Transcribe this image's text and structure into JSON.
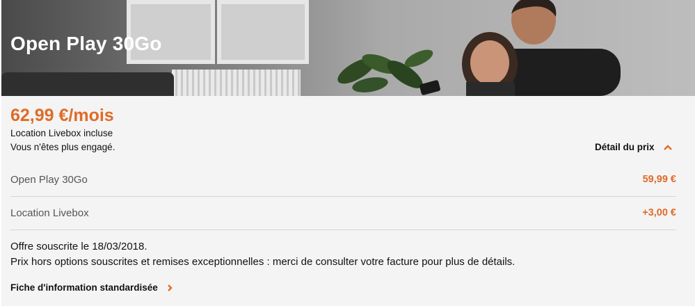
{
  "offer": {
    "title": "Open Play 30Go",
    "price": "62,99 €/mois",
    "line1": "Location Livebox incluse",
    "line2": "Vous n'êtes plus engagé."
  },
  "price_detail": {
    "toggle_label": "Détail du prix",
    "rows": [
      {
        "label": "Open Play 30Go",
        "amount": "59,99 €"
      },
      {
        "label": "Location Livebox",
        "amount": "+3,00 €"
      }
    ]
  },
  "notes": {
    "subscribed": "Offre souscrite le 18/03/2018.",
    "disclaimer": "Prix hors options souscrites et remises exceptionnelles : merci de consulter votre facture pour plus de détails."
  },
  "links": {
    "fiche": "Fiche d'information standardisée"
  },
  "colors": {
    "accent": "#e06b27",
    "panel": "#f4f4f4"
  },
  "icons": {
    "detail_toggle": "chevron-up-icon",
    "fiche_link": "chevron-right-icon"
  }
}
